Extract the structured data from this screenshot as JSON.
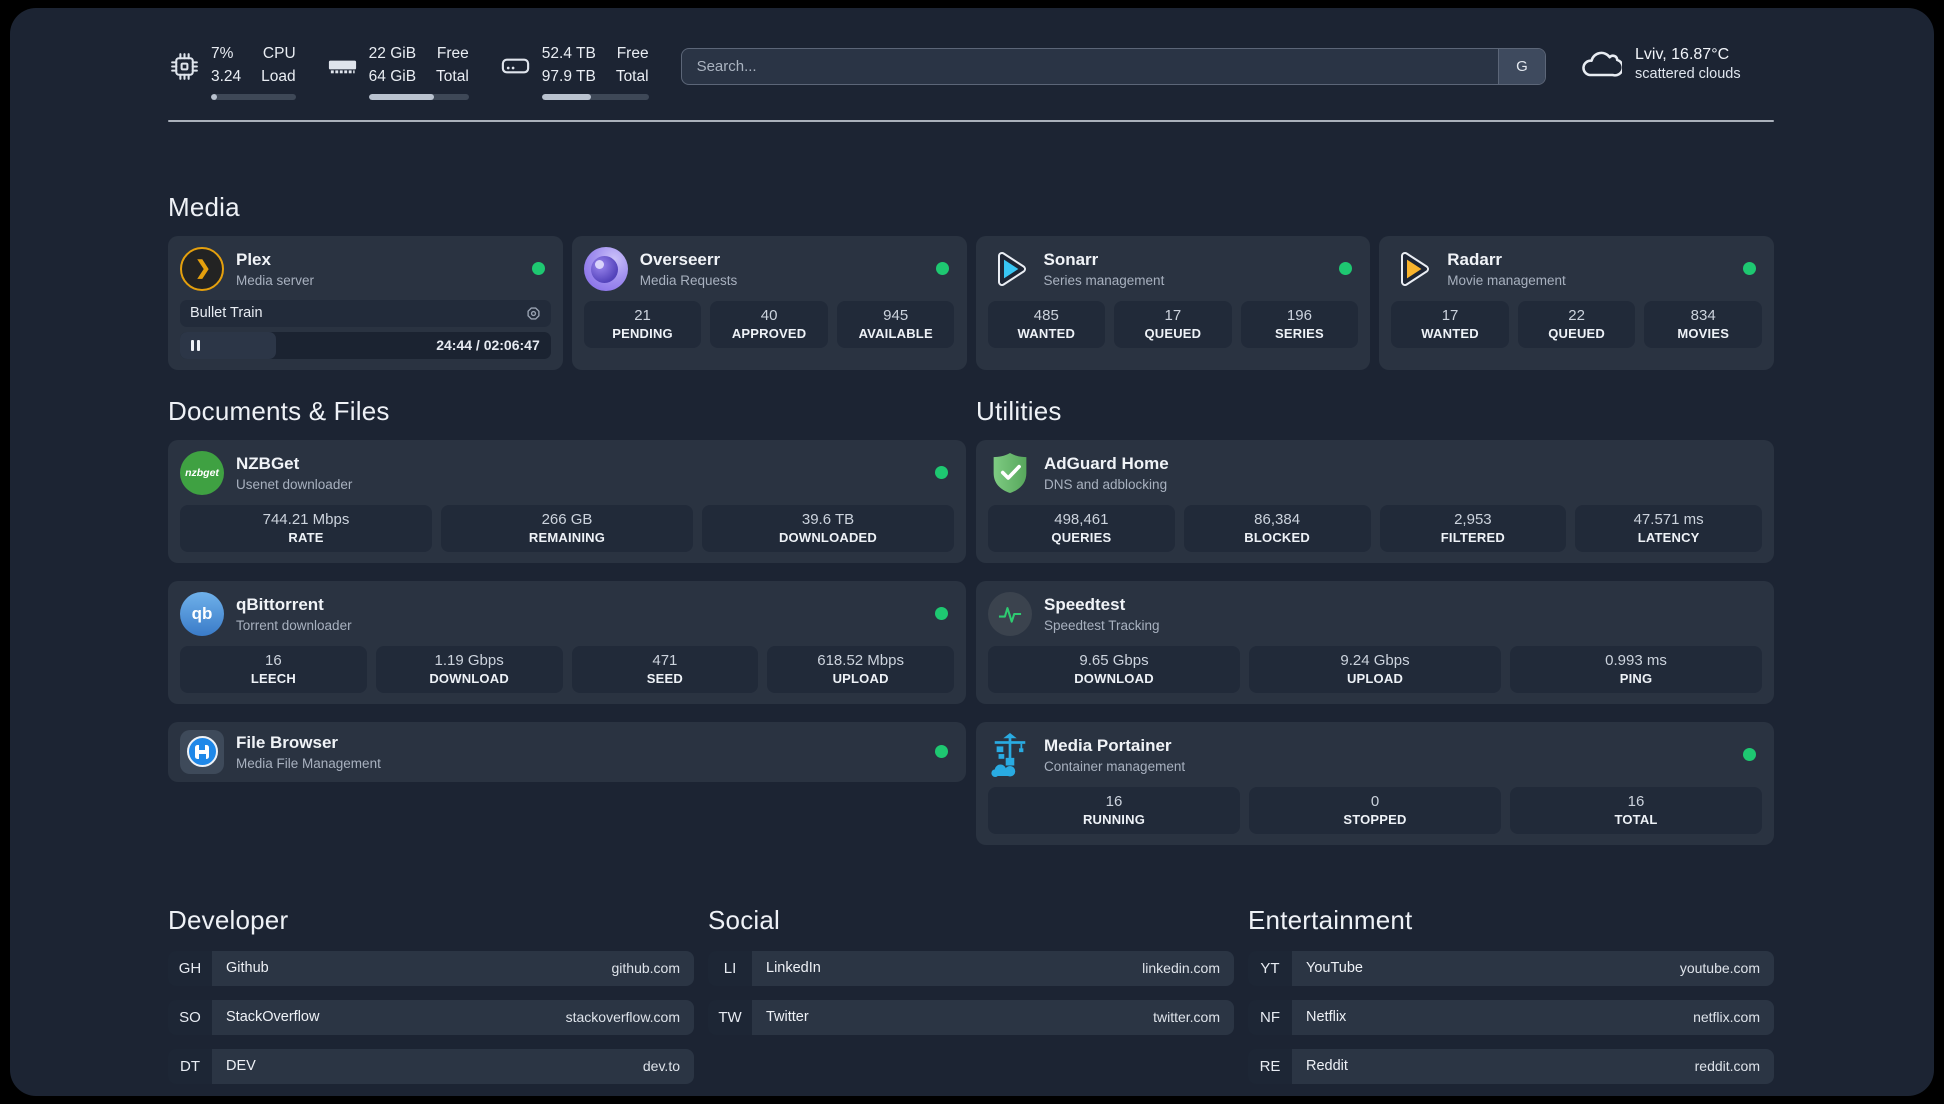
{
  "header": {
    "cpu": {
      "value_top": "7%",
      "value_bottom": "3.24",
      "label_top": "CPU",
      "label_bottom": "Load",
      "progress": 7
    },
    "ram": {
      "value_top": "22 GiB",
      "value_bottom": "64 GiB",
      "label_top": "Free",
      "label_bottom": "Total",
      "progress": 65
    },
    "disk": {
      "value_top": "52.4 TB",
      "value_bottom": "97.9 TB",
      "label_top": "Free",
      "label_bottom": "Total",
      "progress": 46
    },
    "search": {
      "placeholder": "Search...",
      "engine_button": "G"
    },
    "weather": {
      "title": "Lviv, 16.87°C",
      "subtitle": "scattered clouds",
      "icon": "cloud-icon"
    }
  },
  "colors": {
    "page_bg": "#1c2433",
    "card_bg": "#2a3341",
    "stat_box_bg": "#212a39",
    "online_green": "#1ec871",
    "plex_amber": "#e5a00d",
    "sonarr_blue": "#38c6f4",
    "radarr_yellow": "#f9b42d",
    "nzbget_green": "#3fa142",
    "qbittorrent_blue": "#4a8fd3",
    "adguard_green": "#63b566",
    "speedtest_green": "#2ecc71",
    "portainer_blue": "#29abe2",
    "filebrowser_blue": "#1f88e8",
    "overseerr_purple": "#8065e6"
  },
  "media": {
    "title": "Media",
    "plex": {
      "name": "Plex",
      "subtitle": "Media server",
      "icon": "plex-icon",
      "online": true,
      "now_playing": "Bullet Train",
      "time": "24:44 / 02:06:47",
      "progress": 26
    },
    "overseerr": {
      "name": "Overseerr",
      "subtitle": "Media Requests",
      "icon": "overseerr-icon",
      "online": true,
      "stats": [
        {
          "value": "21",
          "label": "PENDING"
        },
        {
          "value": "40",
          "label": "APPROVED"
        },
        {
          "value": "945",
          "label": "AVAILABLE"
        }
      ]
    },
    "sonarr": {
      "name": "Sonarr",
      "subtitle": "Series management",
      "icon": "sonarr-icon",
      "online": true,
      "stats": [
        {
          "value": "485",
          "label": "WANTED"
        },
        {
          "value": "17",
          "label": "QUEUED"
        },
        {
          "value": "196",
          "label": "SERIES"
        }
      ]
    },
    "radarr": {
      "name": "Radarr",
      "subtitle": "Movie management",
      "icon": "radarr-icon",
      "online": true,
      "stats": [
        {
          "value": "17",
          "label": "WANTED"
        },
        {
          "value": "22",
          "label": "QUEUED"
        },
        {
          "value": "834",
          "label": "MOVIES"
        }
      ]
    }
  },
  "documents": {
    "title": "Documents & Files",
    "nzbget": {
      "name": "NZBGet",
      "subtitle": "Usenet downloader",
      "icon": "nzbget-icon",
      "online": true,
      "stats": [
        {
          "value": "744.21 Mbps",
          "label": "RATE"
        },
        {
          "value": "266 GB",
          "label": "REMAINING"
        },
        {
          "value": "39.6 TB",
          "label": "DOWNLOADED"
        }
      ]
    },
    "qbittorrent": {
      "name": "qBittorrent",
      "subtitle": "Torrent downloader",
      "icon": "qbittorrent-icon",
      "online": true,
      "stats": [
        {
          "value": "16",
          "label": "LEECH"
        },
        {
          "value": "1.19 Gbps",
          "label": "DOWNLOAD"
        },
        {
          "value": "471",
          "label": "SEED"
        },
        {
          "value": "618.52 Mbps",
          "label": "UPLOAD"
        }
      ]
    },
    "filebrowser": {
      "name": "File Browser",
      "subtitle": "Media File Management",
      "icon": "filebrowser-icon",
      "online": true
    }
  },
  "utilities": {
    "title": "Utilities",
    "adguard": {
      "name": "AdGuard Home",
      "subtitle": "DNS and adblocking",
      "icon": "adguard-shield-icon",
      "online": false,
      "stats": [
        {
          "value": "498,461",
          "label": "QUERIES"
        },
        {
          "value": "86,384",
          "label": "BLOCKED"
        },
        {
          "value": "2,953",
          "label": "FILTERED"
        },
        {
          "value": "47.571 ms",
          "label": "LATENCY"
        }
      ]
    },
    "speedtest": {
      "name": "Speedtest",
      "subtitle": "Speedtest Tracking",
      "icon": "speedtest-pulse-icon",
      "online": false,
      "stats": [
        {
          "value": "9.65 Gbps",
          "label": "DOWNLOAD"
        },
        {
          "value": "9.24 Gbps",
          "label": "UPLOAD"
        },
        {
          "value": "0.993 ms",
          "label": "PING"
        }
      ]
    },
    "portainer": {
      "name": "Media Portainer",
      "subtitle": "Container management",
      "icon": "portainer-crane-icon",
      "online": true,
      "stats": [
        {
          "value": "16",
          "label": "RUNNING"
        },
        {
          "value": "0",
          "label": "STOPPED"
        },
        {
          "value": "16",
          "label": "TOTAL"
        }
      ]
    }
  },
  "bookmarks": {
    "developer": {
      "title": "Developer",
      "items": [
        {
          "abbr": "GH",
          "name": "Github",
          "url": "github.com"
        },
        {
          "abbr": "SO",
          "name": "StackOverflow",
          "url": "stackoverflow.com"
        },
        {
          "abbr": "DT",
          "name": "DEV",
          "url": "dev.to"
        }
      ]
    },
    "social": {
      "title": "Social",
      "items": [
        {
          "abbr": "LI",
          "name": "LinkedIn",
          "url": "linkedin.com"
        },
        {
          "abbr": "TW",
          "name": "Twitter",
          "url": "twitter.com"
        }
      ]
    },
    "entertainment": {
      "title": "Entertainment",
      "items": [
        {
          "abbr": "YT",
          "name": "YouTube",
          "url": "youtube.com"
        },
        {
          "abbr": "NF",
          "name": "Netflix",
          "url": "netflix.com"
        },
        {
          "abbr": "RE",
          "name": "Reddit",
          "url": "reddit.com"
        }
      ]
    }
  }
}
